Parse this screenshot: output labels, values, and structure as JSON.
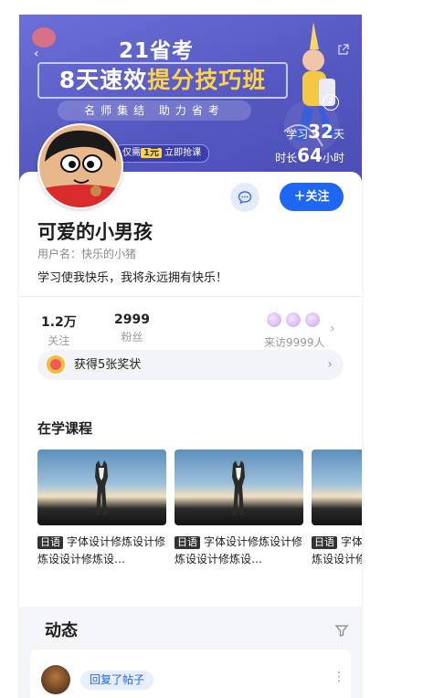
{
  "banner": {
    "line1": "21省考",
    "line2_part1": "8天速效",
    "line2_part2": "提分技巧班",
    "slogan": "名师集结 助力省考",
    "price_prefix": "仅需",
    "price": "1元",
    "price_suffix": "立即抢课",
    "study_days_label_pre": "学习",
    "study_days": "32",
    "study_days_unit": "天",
    "study_hours_label_pre": "时长",
    "study_hours": "64",
    "study_hours_unit": "小时"
  },
  "profile": {
    "name": "可爱的小男孩",
    "username": "用户名：快乐的小猪",
    "signature": "学习使我快乐，我将永远拥有快乐！",
    "follow_label": "关注",
    "stats": [
      {
        "value": "1.2万",
        "label": "关注"
      },
      {
        "value": "2999",
        "label": "粉丝"
      }
    ],
    "visitors_text": "来访9999人",
    "award_text": "获得5张奖状"
  },
  "courses": {
    "title": "在学课程",
    "items": [
      {
        "tag": "日语",
        "title": "字体设计修炼设计修炼设设计修炼设…"
      },
      {
        "tag": "日语",
        "title": "字体设计修炼设计修炼设设计修炼设…"
      },
      {
        "tag": "日语",
        "title": "字体设计修炼设计修炼设设计修炼设…"
      }
    ]
  },
  "feed": {
    "title": "动态",
    "post_action": "回复了帖子"
  },
  "colors": {
    "primary": "#1f66f2",
    "banner": "#5457bf",
    "accent_yellow": "#ffd24a"
  }
}
